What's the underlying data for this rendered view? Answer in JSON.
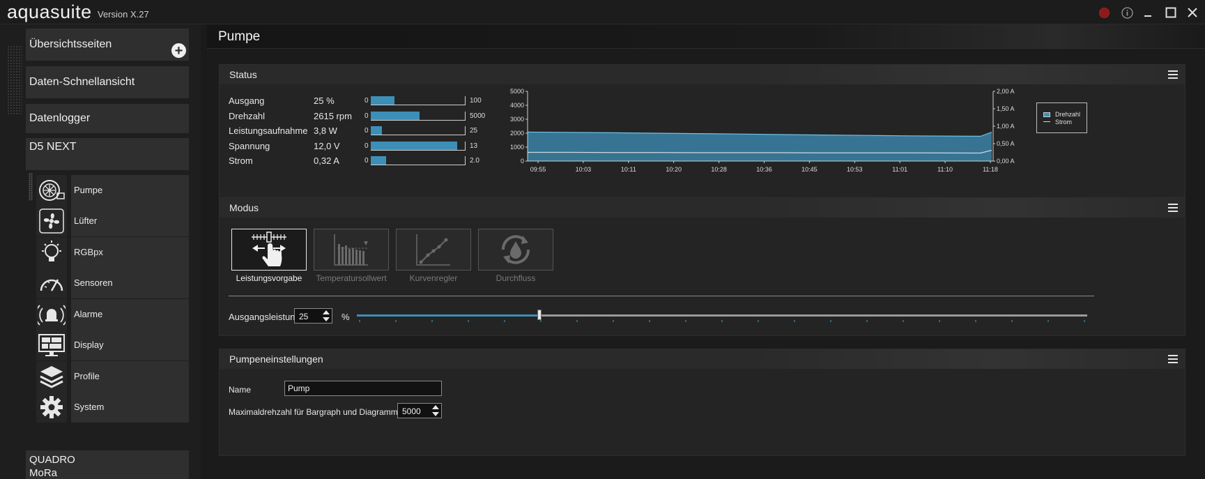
{
  "app": {
    "name": "aquasuite",
    "version": "Version X.27"
  },
  "sidebar": {
    "overview": "Übersichtsseiten",
    "quickview": "Daten-Schnellansicht",
    "datalogger": "Datenlogger",
    "device": "D5 NEXT",
    "sub_items": [
      {
        "label": "Pumpe",
        "icon": "pump-icon"
      },
      {
        "label": "Lüfter",
        "icon": "fan-icon"
      },
      {
        "label": "RGBpx",
        "icon": "lightbulb-icon"
      },
      {
        "label": "Sensoren",
        "icon": "gauge-icon"
      },
      {
        "label": "Alarme",
        "icon": "alarm-bell-icon"
      },
      {
        "label": "Display",
        "icon": "display-icon"
      },
      {
        "label": "Profile",
        "icon": "layers-icon"
      },
      {
        "label": "System",
        "icon": "gear-icon"
      }
    ],
    "quadro": "QUADRO",
    "mora": "MoRa"
  },
  "page": {
    "title": "Pumpe"
  },
  "status": {
    "title": "Status",
    "rows": [
      {
        "label": "Ausgang",
        "value": "25 %",
        "min": "0",
        "max": "100",
        "fill": 0.25
      },
      {
        "label": "Drehzahl",
        "value": "2615 rpm",
        "min": "0",
        "max": "5000",
        "fill": 0.52
      },
      {
        "label": "Leistungsaufnahme",
        "value": "3,8 W",
        "min": "0",
        "max": "25",
        "fill": 0.12
      },
      {
        "label": "Spannung",
        "value": "12,0 V",
        "min": "0",
        "max": "13",
        "fill": 0.92
      },
      {
        "label": "Strom",
        "value": "0,32 A",
        "min": "0",
        "max": "2.0",
        "fill": 0.16
      }
    ]
  },
  "chart_data": {
    "type": "area",
    "x": [
      "09:55",
      "10:03",
      "10:11",
      "10:20",
      "10:28",
      "10:36",
      "10:45",
      "10:53",
      "11:01",
      "11:10",
      "11:18"
    ],
    "y_left_ticks": [
      "5000",
      "4000",
      "3000",
      "2000",
      "1000",
      "0"
    ],
    "y_right_ticks": [
      "2,00 A",
      "1,50 A",
      "1,00 A",
      "0,50 A",
      "0,00 A"
    ],
    "ylim_left": [
      0,
      5000
    ],
    "ylim_right": [
      0,
      2
    ],
    "series": [
      {
        "name": "Drehzahl",
        "axis": "left",
        "color": "#3d8fb8",
        "values": [
          2080,
          2060,
          2030,
          2000,
          1970,
          1940,
          1900,
          1870,
          1840,
          1810,
          1780,
          2070
        ]
      },
      {
        "name": "Strom",
        "axis": "right",
        "color": "#cfd8dc",
        "values": [
          0.25,
          0.25,
          0.245,
          0.245,
          0.24,
          0.24,
          0.24,
          0.235,
          0.235,
          0.235,
          0.23,
          0.31
        ]
      }
    ],
    "legend_position": "top-right"
  },
  "modus": {
    "title": "Modus",
    "modes": [
      {
        "label": "Leistungsvorgabe",
        "active": true
      },
      {
        "label": "Temperatursollwert",
        "active": false
      },
      {
        "label": "Kurvenregler",
        "active": false
      },
      {
        "label": "Durchfluss",
        "active": false
      }
    ],
    "output_label": "Ausgangsleistung",
    "output_value": "25",
    "output_unit": "%",
    "slider_fraction": 0.25
  },
  "settings": {
    "title": "Pumpeneinstellungen",
    "name_label": "Name",
    "name_value": "Pump",
    "maxrpm_label": "Maximaldrehzahl für Bargraph und Diagramm",
    "maxrpm_value": "5000"
  },
  "colors": {
    "accent": "#3d8fb8",
    "background": "#1b1b1b",
    "panel": "#242424"
  }
}
